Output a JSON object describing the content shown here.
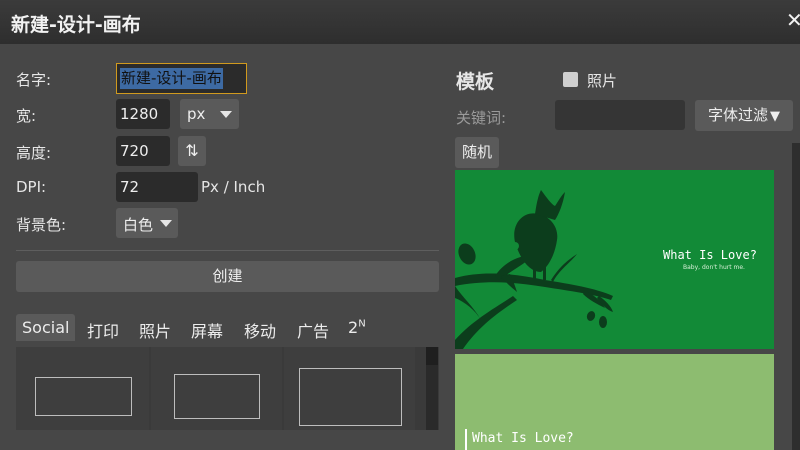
{
  "window": {
    "title": "新建-设计-画布"
  },
  "form": {
    "name_label": "名字:",
    "name_value": "新建-设计-画布",
    "width_label": "宽:",
    "width_value": "1280",
    "unit_value": "px",
    "height_label": "高度:",
    "height_value": "720",
    "dpi_label": "DPI:",
    "dpi_value": "72",
    "dpi_unit": "Px / Inch",
    "bg_label": "背景色:",
    "bg_value": "白色",
    "create_button": "创建"
  },
  "preset_tabs": [
    {
      "label": "Social"
    },
    {
      "label": "打印"
    },
    {
      "label": "照片"
    },
    {
      "label": "屏幕"
    },
    {
      "label": "移动"
    },
    {
      "label": "广告"
    },
    {
      "label": "2"
    }
  ],
  "preset_tab_sup": "N",
  "templates": {
    "heading": "模板",
    "photo_label": "照片",
    "keyword_label": "关键词:",
    "font_filter_button": "字体过滤",
    "random_button": "随机",
    "cards": [
      {
        "title": "What Is Love?",
        "subtitle": "Baby, don't hurt me.",
        "bg": "#128a37"
      },
      {
        "title": "What Is Love?",
        "bg": "#8dbc70"
      }
    ]
  },
  "colors": {
    "accent_border": "#d19a1e",
    "selection": "#3d6aa3",
    "card_dark_green": "#0c3d1c"
  }
}
